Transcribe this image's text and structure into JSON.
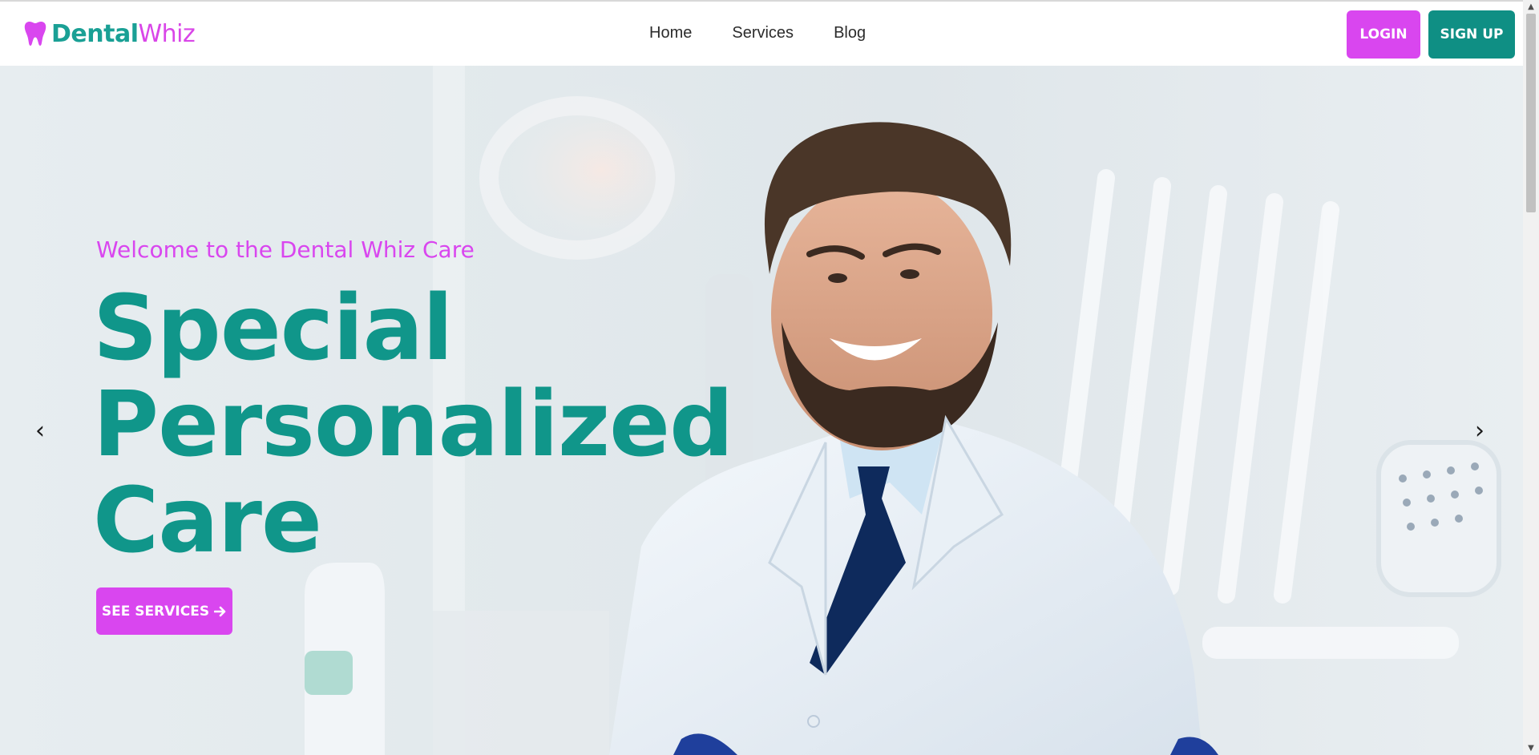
{
  "header": {
    "logo": {
      "part1": "Dental",
      "part2": "Whiz",
      "icon": "tooth-icon"
    },
    "nav": [
      {
        "label": "Home"
      },
      {
        "label": "Services"
      },
      {
        "label": "Blog"
      }
    ],
    "login_label": "LOGIN",
    "signup_label": "SIGN UP"
  },
  "hero": {
    "eyebrow": "Welcome to the Dental Whiz Care",
    "headline_lines": [
      "Special",
      "Personalized",
      "Care"
    ],
    "cta_label": "SEE SERVICES",
    "cta_icon": "arrow-right-icon",
    "prev_arrow": "‹",
    "next_arrow": "›"
  },
  "colors": {
    "brand_teal": "#10968a",
    "brand_magenta": "#d946ef",
    "signup_bg": "#0f8f84"
  },
  "scrollbar": {
    "up": "▲",
    "down": "▼"
  }
}
